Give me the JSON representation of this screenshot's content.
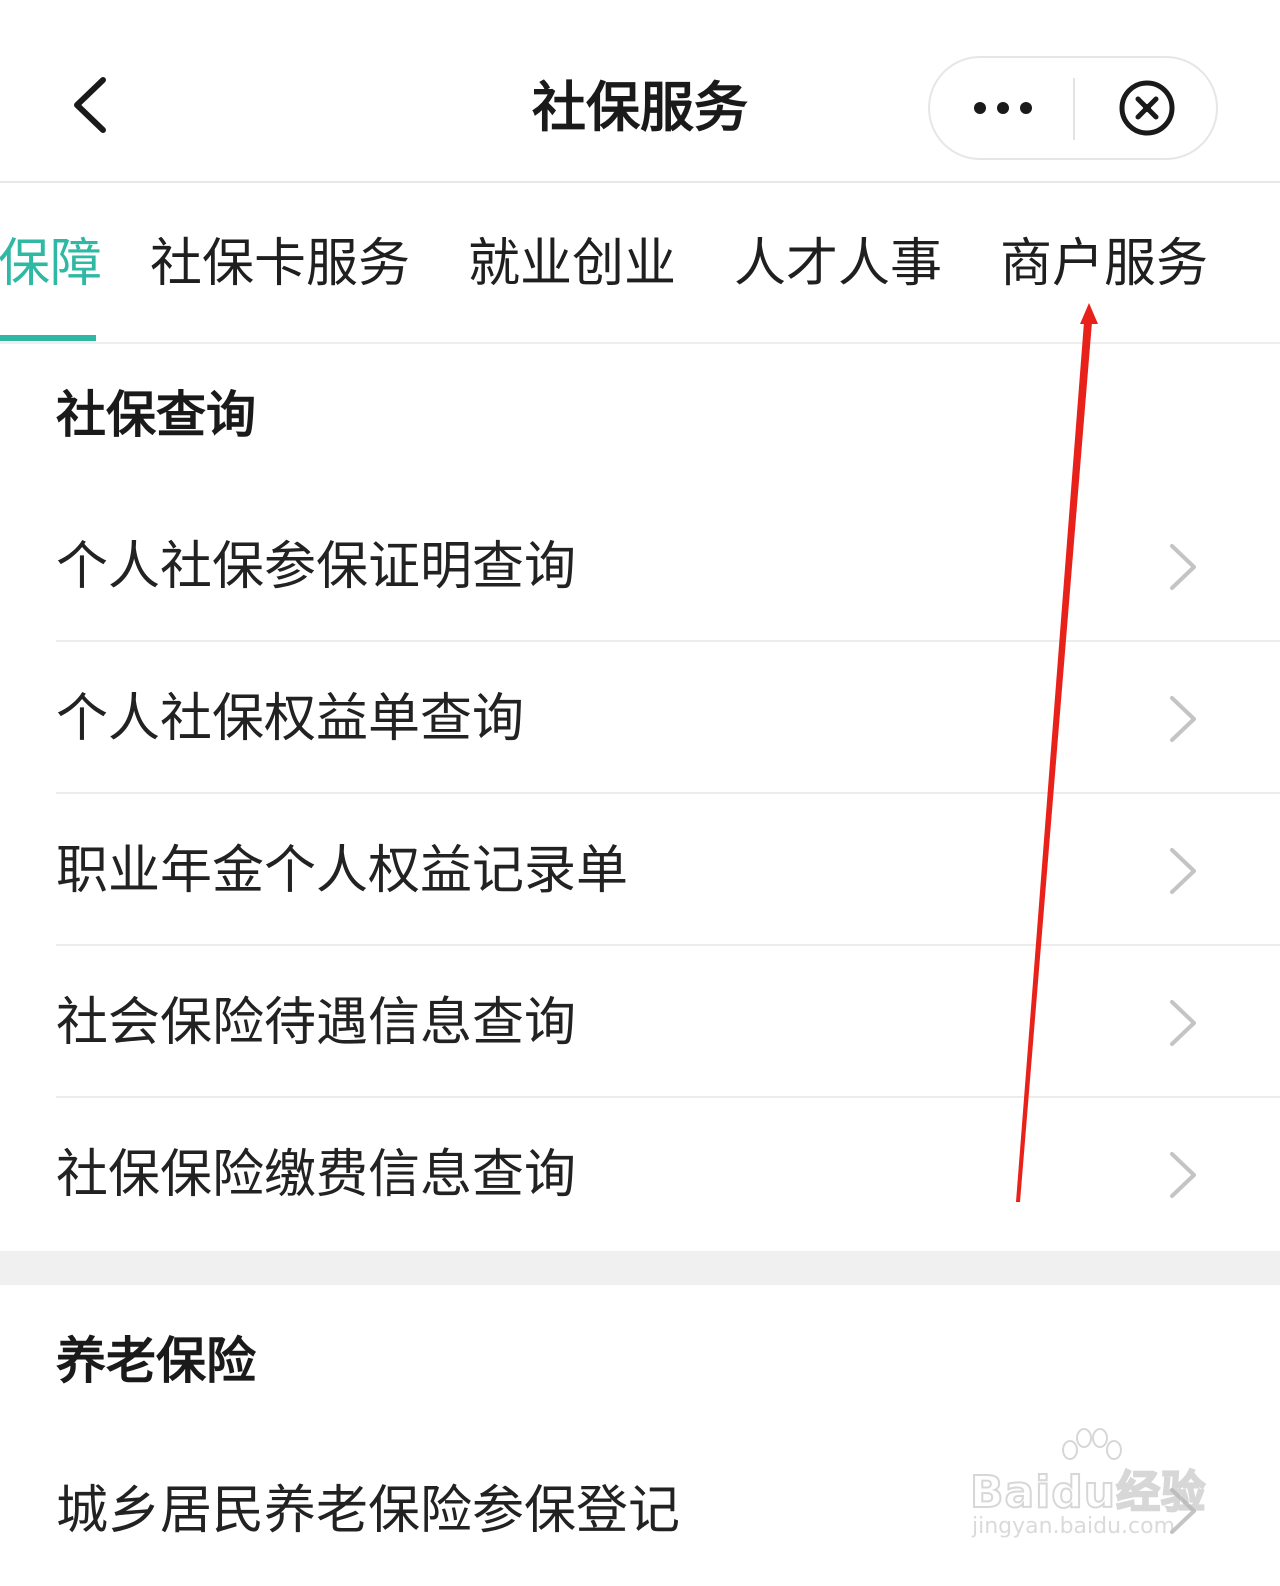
{
  "header": {
    "title": "社保服务",
    "back_icon": "chevron-left-icon",
    "more_icon": "more-dots-icon",
    "close_icon": "close-circle-icon"
  },
  "tabs": [
    {
      "label": "保障",
      "active": true
    },
    {
      "label": "社保卡服务",
      "active": false
    },
    {
      "label": "就业创业",
      "active": false
    },
    {
      "label": "人才人事",
      "active": false
    },
    {
      "label": "商户服务",
      "active": false
    }
  ],
  "sections": [
    {
      "title": "社保查询",
      "items": [
        {
          "label": "个人社保参保证明查询"
        },
        {
          "label": "个人社保权益单查询"
        },
        {
          "label": "职业年金个人权益记录单"
        },
        {
          "label": "社会保险待遇信息查询"
        },
        {
          "label": "社保保险缴费信息查询"
        }
      ]
    },
    {
      "title": "养老保险",
      "items": [
        {
          "label": "城乡居民养老保险参保登记"
        }
      ]
    }
  ],
  "watermark": {
    "brand": "Baidu经验",
    "url": "jingyan.baidu.com"
  },
  "colors": {
    "accent": "#2fb8a3",
    "annotation_arrow": "#e8221b"
  }
}
